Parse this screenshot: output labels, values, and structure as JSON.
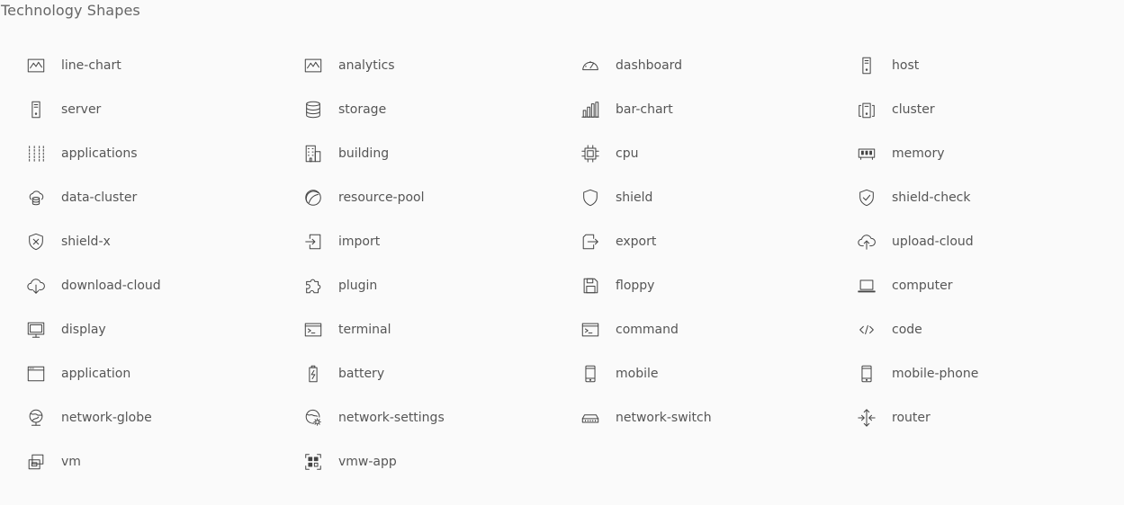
{
  "page": {
    "title": "Technology Shapes"
  },
  "shapes": [
    {
      "label": "line-chart",
      "icon": "line-chart-icon"
    },
    {
      "label": "analytics",
      "icon": "analytics-icon"
    },
    {
      "label": "dashboard",
      "icon": "dashboard-icon"
    },
    {
      "label": "host",
      "icon": "host-icon"
    },
    {
      "label": "server",
      "icon": "server-icon"
    },
    {
      "label": "storage",
      "icon": "storage-icon"
    },
    {
      "label": "bar-chart",
      "icon": "bar-chart-icon"
    },
    {
      "label": "cluster",
      "icon": "cluster-icon"
    },
    {
      "label": "applications",
      "icon": "applications-icon"
    },
    {
      "label": "building",
      "icon": "building-icon"
    },
    {
      "label": "cpu",
      "icon": "cpu-icon"
    },
    {
      "label": "memory",
      "icon": "memory-icon"
    },
    {
      "label": "data-cluster",
      "icon": "data-cluster-icon"
    },
    {
      "label": "resource-pool",
      "icon": "resource-pool-icon"
    },
    {
      "label": "shield",
      "icon": "shield-icon"
    },
    {
      "label": "shield-check",
      "icon": "shield-check-icon"
    },
    {
      "label": "shield-x",
      "icon": "shield-x-icon"
    },
    {
      "label": "import",
      "icon": "import-icon"
    },
    {
      "label": "export",
      "icon": "export-icon"
    },
    {
      "label": "upload-cloud",
      "icon": "upload-cloud-icon"
    },
    {
      "label": "download-cloud",
      "icon": "download-cloud-icon"
    },
    {
      "label": "plugin",
      "icon": "plugin-icon"
    },
    {
      "label": "floppy",
      "icon": "floppy-icon"
    },
    {
      "label": "computer",
      "icon": "computer-icon"
    },
    {
      "label": "display",
      "icon": "display-icon"
    },
    {
      "label": "terminal",
      "icon": "terminal-icon"
    },
    {
      "label": "command",
      "icon": "command-icon"
    },
    {
      "label": "code",
      "icon": "code-icon"
    },
    {
      "label": "application",
      "icon": "application-icon"
    },
    {
      "label": "battery",
      "icon": "battery-icon"
    },
    {
      "label": "mobile",
      "icon": "mobile-icon"
    },
    {
      "label": "mobile-phone",
      "icon": "mobile-phone-icon"
    },
    {
      "label": "network-globe",
      "icon": "network-globe-icon"
    },
    {
      "label": "network-settings",
      "icon": "network-settings-icon"
    },
    {
      "label": "network-switch",
      "icon": "network-switch-icon"
    },
    {
      "label": "router",
      "icon": "router-icon"
    },
    {
      "label": "vm",
      "icon": "vm-icon"
    },
    {
      "label": "vmw-app",
      "icon": "vmw-app-icon"
    }
  ]
}
